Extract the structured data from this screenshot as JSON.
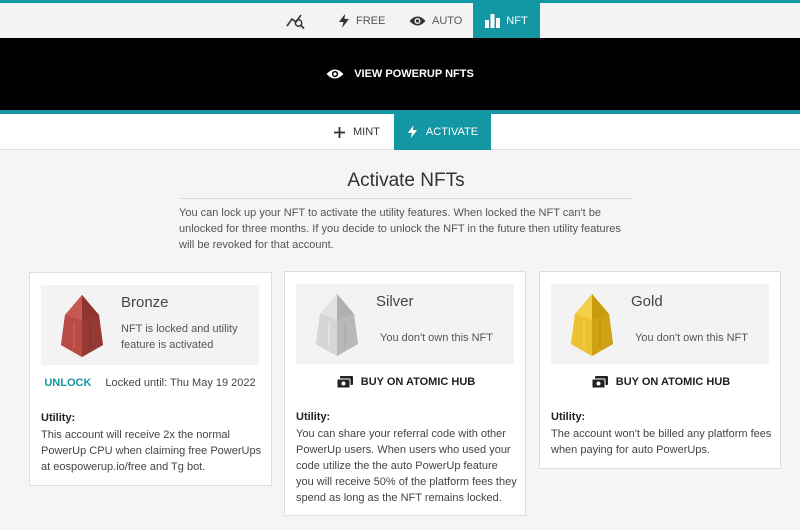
{
  "topnav": {
    "tabs": [
      {
        "label": "",
        "icon": "chart-search-icon"
      },
      {
        "label": "FREE",
        "icon": "bolt-icon"
      },
      {
        "label": "AUTO",
        "icon": "eye-icon"
      },
      {
        "label": "NFT",
        "icon": "bar-chart-icon",
        "active": true
      }
    ]
  },
  "hero": {
    "label": "VIEW POWERUP NFTS",
    "icon": "eye-icon"
  },
  "subnav": {
    "mint_label": "MINT",
    "activate_label": "ACTIVATE"
  },
  "main": {
    "title": "Activate NFTs",
    "intro": "You can lock up your NFT to activate the utility features. When locked the NFT can't be unlocked for three months. If you decide to unlock the NFT in the future then utility features will be revoked for that account."
  },
  "cards": [
    {
      "tier": "Bronze",
      "status": "NFT is locked and utility feature is activated",
      "action_label": "UNLOCK",
      "locked_until": "Locked until: Thu May 19 2022",
      "utility_heading": "Utility:",
      "utility_text": "This account will receive 2x the normal PowerUp CPU when claiming free PowerUps at eospowerup.io/free and Tg bot.",
      "gem_color": "#b5413c"
    },
    {
      "tier": "Silver",
      "status": "You don't own this NFT",
      "action_label": "BUY ON ATOMIC HUB",
      "utility_heading": "Utility:",
      "utility_text": "You can share your referral code with other PowerUp users. When users who used your code utilize the the auto PowerUp feature you will receive 50% of the platform fees they spend as long as the NFT remains locked.",
      "gem_color": "#c9c9c9"
    },
    {
      "tier": "Gold",
      "status": "You don't own this NFT",
      "action_label": "BUY ON ATOMIC HUB",
      "utility_heading": "Utility:",
      "utility_text": "The account won't be billed any platform fees when paying for auto PowerUps.",
      "gem_color": "#e2b51e"
    }
  ],
  "colors": {
    "accent": "#1497a4",
    "hero_bg": "#000000"
  }
}
